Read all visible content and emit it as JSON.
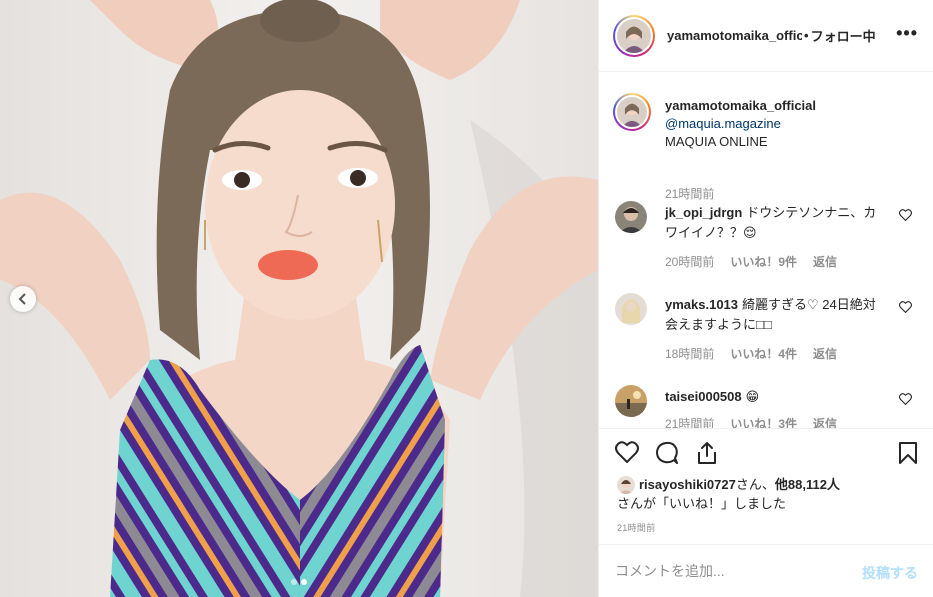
{
  "post": {
    "image_alt": "photo"
  },
  "header": {
    "username": "yamamotomaika_official",
    "separator": "•",
    "follow_status": "フォロー中",
    "more": "•••"
  },
  "caption": {
    "username": "yamamotomaika_official",
    "mention": "@maquia.magazine",
    "text": "MAQUIA ONLINE",
    "time": "21時間前"
  },
  "comments": [
    {
      "username": "jk_opi_jdrgn",
      "text": "ドウシテソンナニ、カワイイノ？？😌",
      "time": "20時間前",
      "likes": "いいね！9件",
      "reply": "返信"
    },
    {
      "username": "ymaks.1013",
      "text": "綺麗すぎる♡ 24日絶対会えますように□□",
      "time": "18時間前",
      "likes": "いいね！4件",
      "reply": "返信"
    },
    {
      "username": "taisei000508",
      "text": "😁",
      "time": "21時間前",
      "likes": "いいね！3件",
      "reply": "返信"
    }
  ],
  "likes": {
    "user": "risayoshiki0727",
    "middle": "さん、",
    "count": "他88,112人",
    "line2": "さんが「いいね！」しました"
  },
  "post_time": "21時間前",
  "add_comment": {
    "placeholder": "コメントを追加...",
    "post_label": "投稿する"
  },
  "carousel": {
    "total": 2,
    "current": 2
  },
  "colors": {
    "link": "#003569",
    "muted": "#8e8e8e",
    "post_button": "#b2dffc",
    "dress_purple": "#4b2a8c",
    "dress_teal": "#6fd3cf",
    "dress_orange": "#f0a04b"
  }
}
